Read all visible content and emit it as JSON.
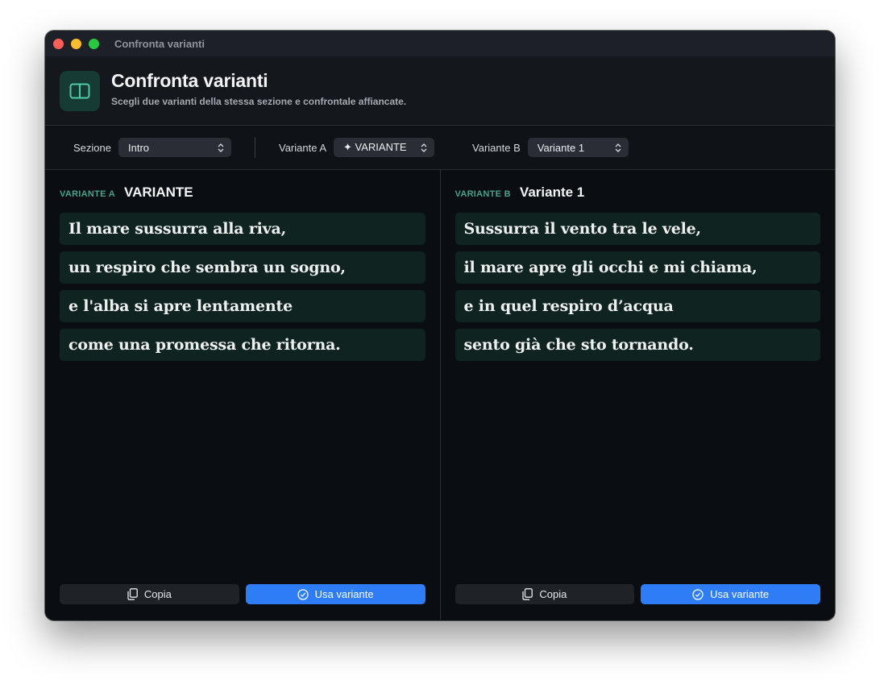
{
  "window": {
    "title": "Confronta varianti"
  },
  "header": {
    "title": "Confronta varianti",
    "subtitle": "Scegli due varianti della stessa sezione e confrontale affiancate.",
    "icon": "split-view-icon"
  },
  "toolbar": {
    "section_label": "Sezione",
    "section_value": "Intro",
    "variant_a_label": "Variante A",
    "variant_a_value": "✦ VARIANTE",
    "variant_b_label": "Variante B",
    "variant_b_value": "Variante 1"
  },
  "panes": [
    {
      "tag": "VARIANTE A",
      "name": "VARIANTE",
      "lines": [
        "Il mare sussurra alla riva,",
        "un respiro che sembra un sogno,",
        "e l'alba si apre lentamente",
        "come una promessa che ritorna."
      ],
      "copy_label": "Copia",
      "use_label": "Usa variante"
    },
    {
      "tag": "VARIANTE B",
      "name": "Variante 1",
      "lines": [
        "Sussurra il vento tra le vele,",
        "il mare apre gli occhi e mi chiama,",
        "e in quel respiro d’acqua",
        "sento già che sto tornando."
      ],
      "copy_label": "Copia",
      "use_label": "Usa variante"
    }
  ],
  "colors": {
    "accent": "#2e7df6",
    "tag": "#48a38a",
    "line_bg": "#0f2321",
    "window_bg": "#0a0d11"
  }
}
